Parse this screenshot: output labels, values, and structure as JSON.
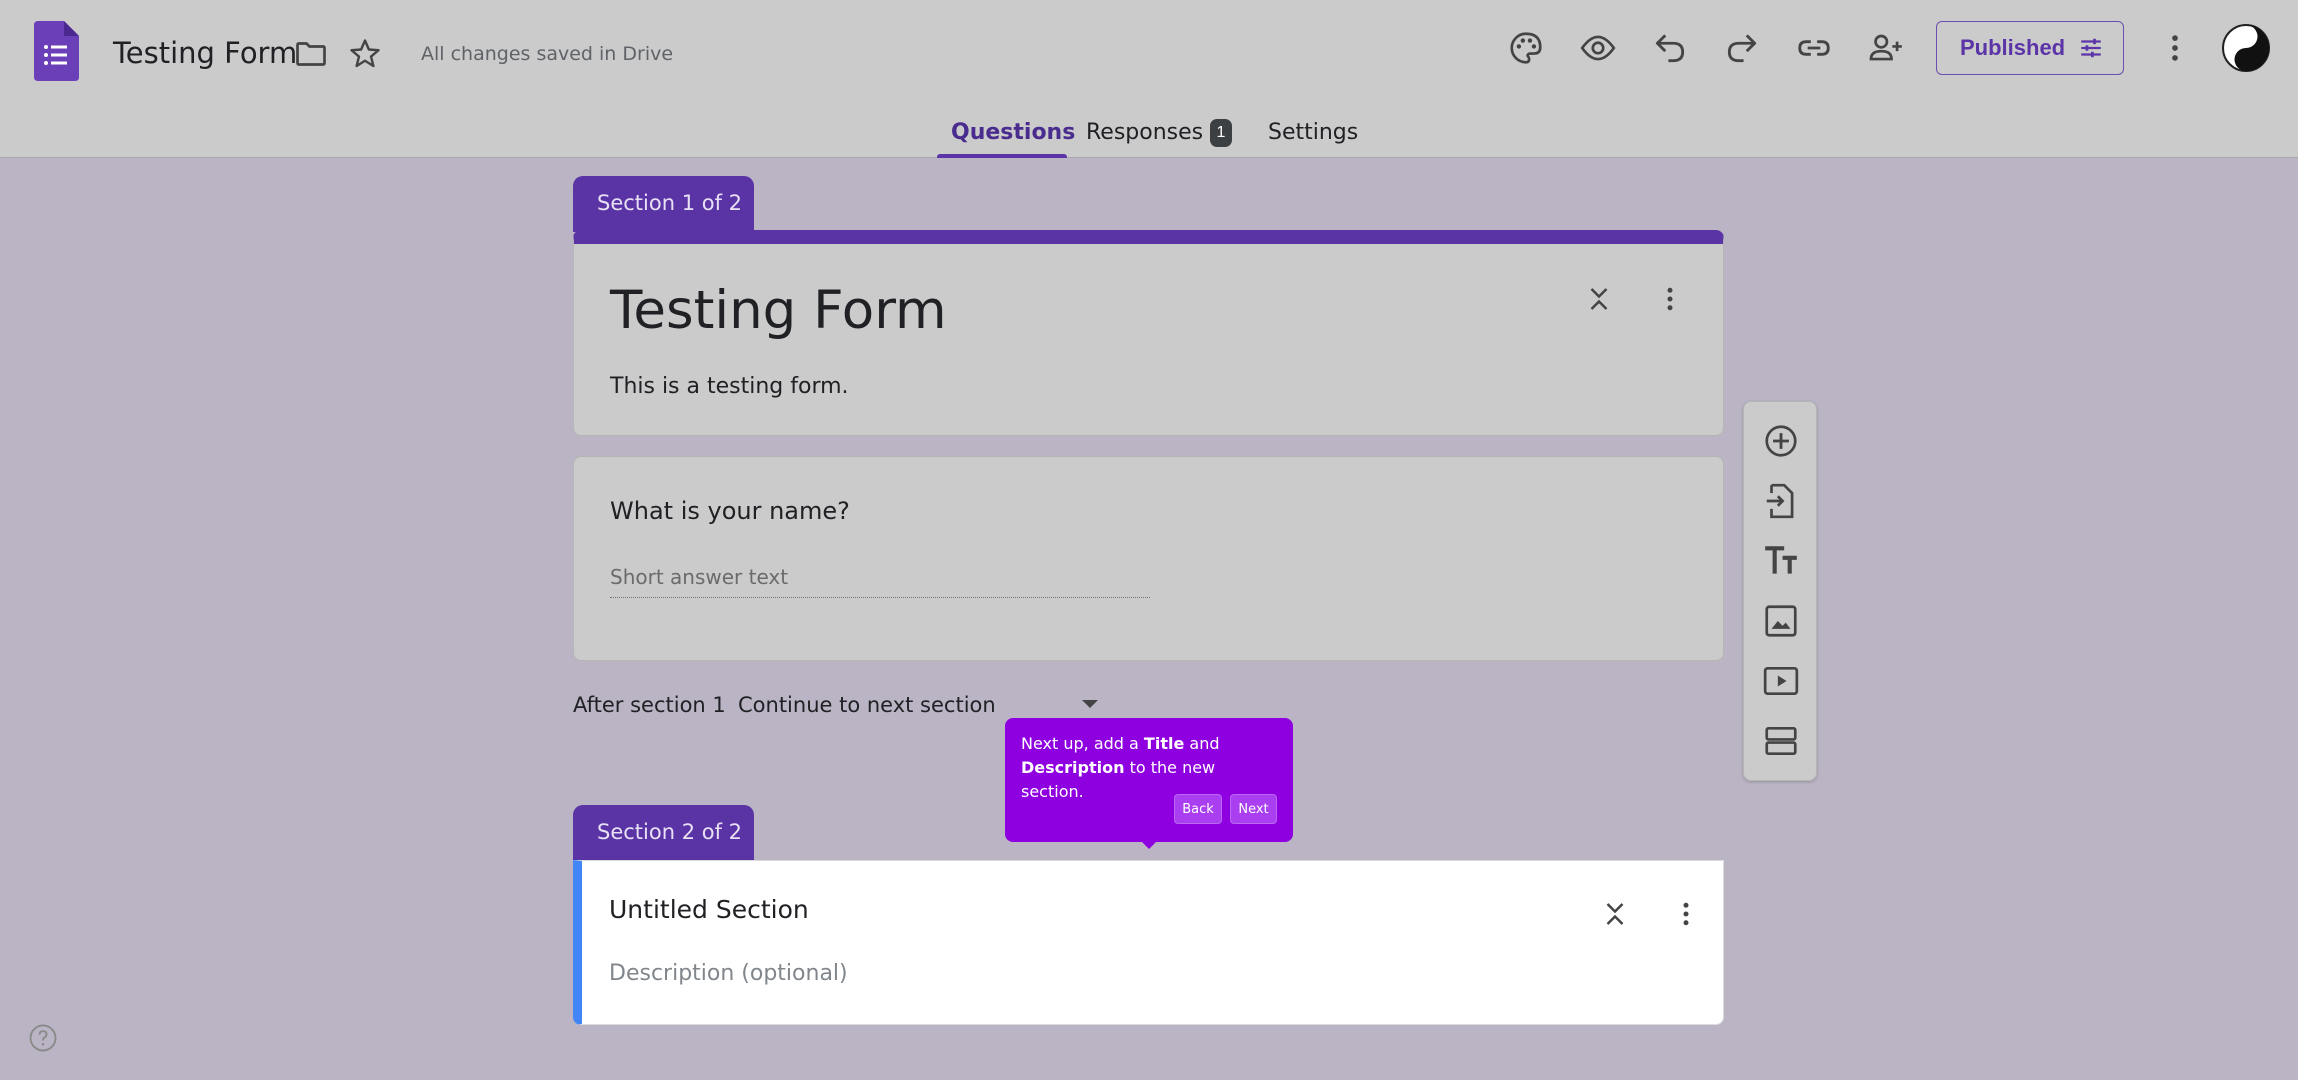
{
  "header": {
    "doc_title": "Testing Form",
    "save_status": "All changes saved in Drive",
    "publish_label": "Published",
    "icons": [
      "palette-icon",
      "preview-eye-icon",
      "undo-icon",
      "redo-icon",
      "link-icon",
      "add-collaborator-icon",
      "more-vert-icon"
    ]
  },
  "tabs": [
    {
      "label": "Questions",
      "active": true
    },
    {
      "label": "Responses",
      "badge": "1"
    },
    {
      "label": "Settings"
    }
  ],
  "section1": {
    "tab_label": "Section 1 of 2",
    "title": "Testing Form",
    "description": "This is a testing form."
  },
  "question1": {
    "title": "What is your name?",
    "placeholder": "Short answer text"
  },
  "after_section": {
    "label": "After section 1",
    "value": "Continue to next section"
  },
  "tooltip": {
    "text_before_title": "Next up, add a ",
    "title_word": "Title",
    "text_and": " and",
    "description_word": "Description",
    "text_after": " to the new section.",
    "back_label": "Back",
    "next_label": "Next"
  },
  "section2": {
    "tab_label": "Section 2 of 2",
    "title": "Untitled Section",
    "description_placeholder": "Description (optional)"
  },
  "side_toolbar": [
    "add-question-icon",
    "import-questions-icon",
    "add-title-icon",
    "add-image-icon",
    "add-video-icon",
    "add-section-icon"
  ],
  "colors": {
    "brand_purple": "#5a34a5",
    "tooltip_purple": "#8f00e0",
    "section_accent_blue": "#4285f4"
  }
}
